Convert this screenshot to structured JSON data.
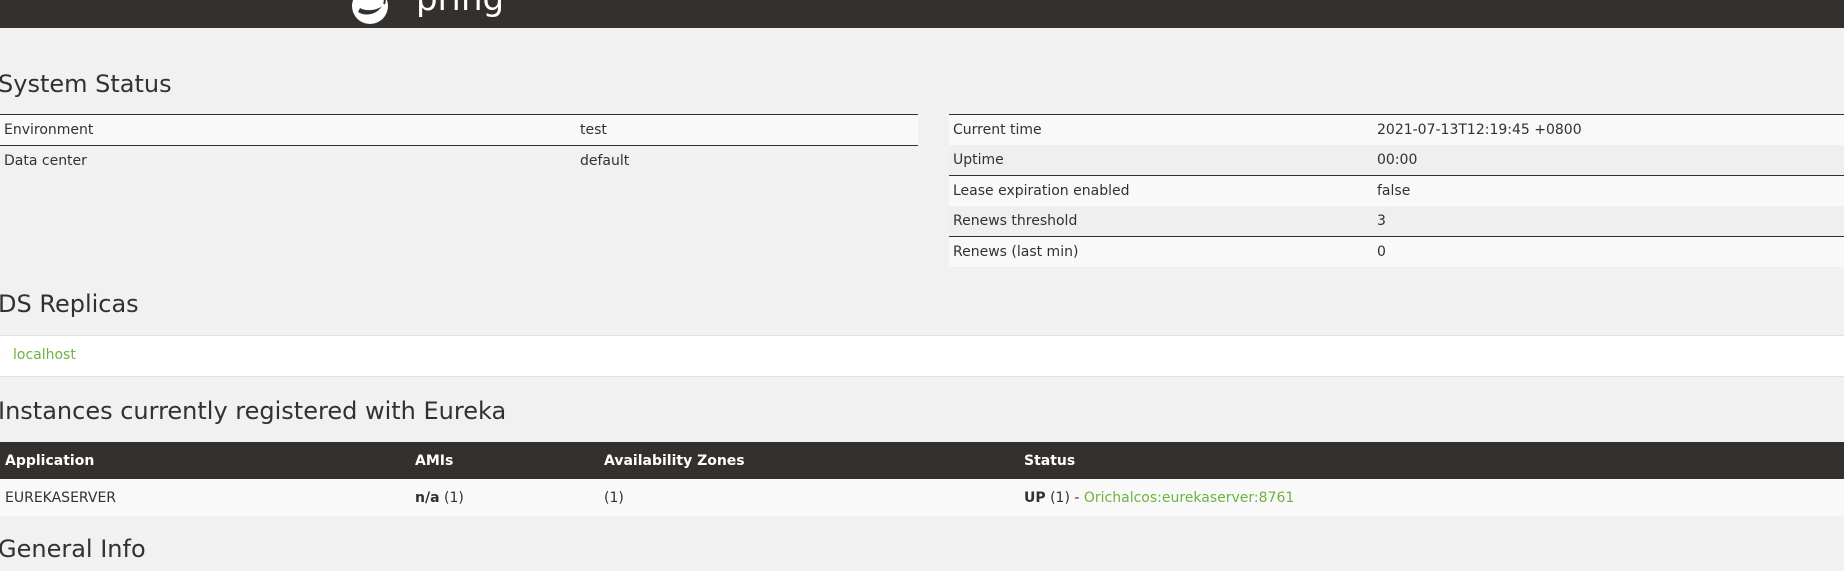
{
  "system_status": {
    "heading": "System Status",
    "left_rows": [
      {
        "label": "Environment",
        "value": "test"
      },
      {
        "label": "Data center",
        "value": "default"
      }
    ],
    "right_rows": [
      {
        "label": "Current time",
        "value": "2021-07-13T12:19:45 +0800"
      },
      {
        "label": "Uptime",
        "value": "00:00"
      },
      {
        "label": "Lease expiration enabled",
        "value": "false"
      },
      {
        "label": "Renews threshold",
        "value": "3"
      },
      {
        "label": "Renews (last min)",
        "value": "0"
      }
    ]
  },
  "ds_replicas": {
    "heading": "DS Replicas",
    "items": [
      "localhost"
    ]
  },
  "instances": {
    "heading": "Instances currently registered with Eureka",
    "columns": [
      "Application",
      "AMIs",
      "Availability Zones",
      "Status"
    ],
    "rows": [
      {
        "application": "EUREKASERVER",
        "ami_value": "n/a",
        "ami_count": " (1)",
        "zones": "(1)",
        "status": "UP",
        "status_count": " (1) - ",
        "instance_link": "Orichalcos:eurekaserver:8761"
      }
    ]
  },
  "general_info": {
    "heading": "General Info"
  },
  "colors": {
    "header_bg": "#34302d",
    "link": "#6db33f",
    "page_bg": "#f1f1f1"
  }
}
